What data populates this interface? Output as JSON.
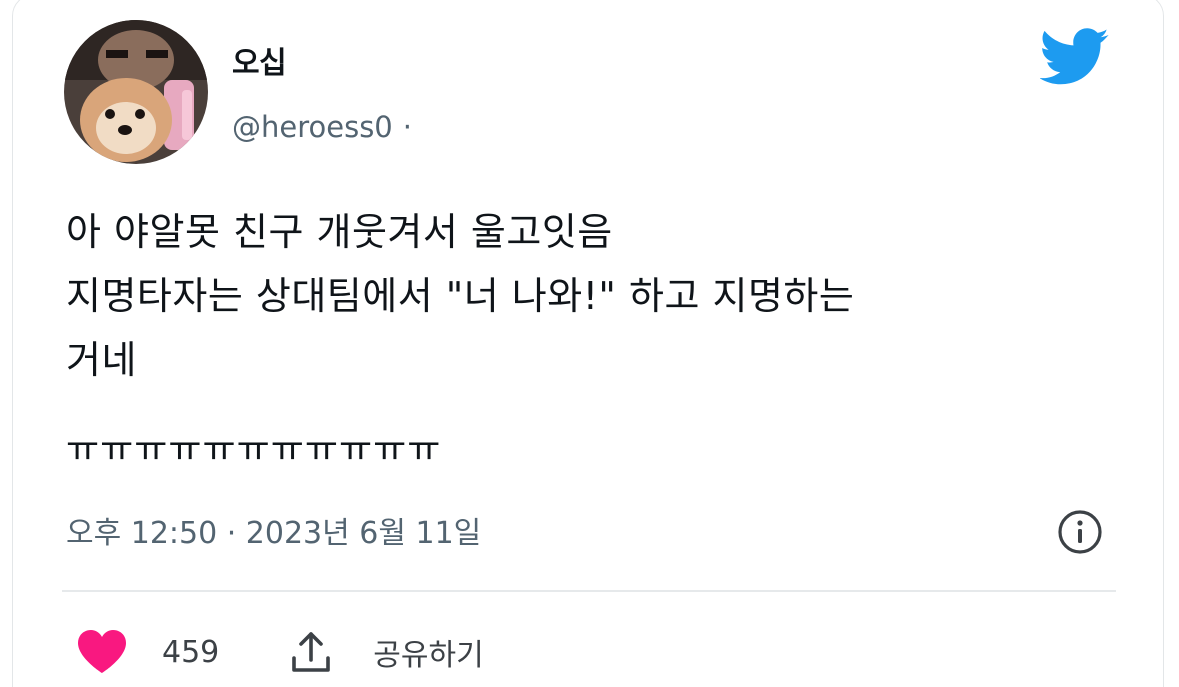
{
  "tweet": {
    "display_name": "오십",
    "handle": "@heroess0",
    "handle_separator": "·",
    "text": "아 야알못 친구 개웃겨서 울고잇음\n지명타자는 상대팀에서 \"너 나와!\" 하고 지명하는\n거네",
    "tail": "ㅠㅠㅠㅠㅠㅠㅠㅠㅠㅠㅠ",
    "timestamp": "오후 12:50 · 2023년 6월 11일"
  },
  "actions": {
    "like_count": "459",
    "share_label": "공유하기"
  },
  "icons": {
    "brand": "twitter-bird-icon",
    "info": "info-icon",
    "like": "heart-icon",
    "share": "share-icon"
  },
  "colors": {
    "twitter_blue": "#1d9bf0",
    "like_pink": "#f91880",
    "secondary_text": "#536471",
    "primary_text": "#0f1419"
  }
}
